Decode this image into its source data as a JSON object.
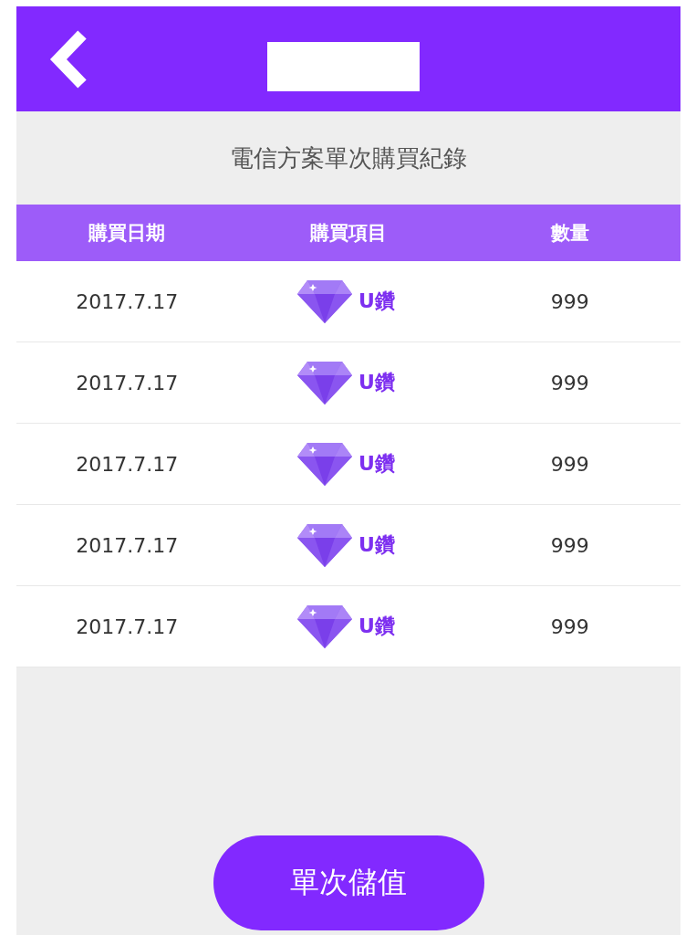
{
  "header": {
    "title_redacted": true
  },
  "subtitle": "電信方案單次購買紀錄",
  "table": {
    "columns": [
      "購買日期",
      "購買項目",
      "數量"
    ],
    "rows": [
      {
        "date": "2017.7.17",
        "item": "U鑽",
        "quantity": "999"
      },
      {
        "date": "2017.7.17",
        "item": "U鑽",
        "quantity": "999"
      },
      {
        "date": "2017.7.17",
        "item": "U鑽",
        "quantity": "999"
      },
      {
        "date": "2017.7.17",
        "item": "U鑽",
        "quantity": "999"
      },
      {
        "date": "2017.7.17",
        "item": "U鑽",
        "quantity": "999"
      }
    ]
  },
  "button": "單次儲值"
}
